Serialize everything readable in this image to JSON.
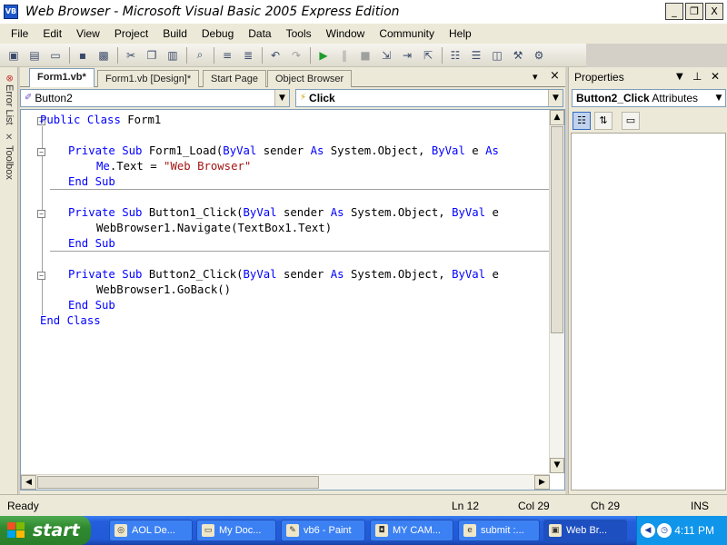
{
  "window": {
    "title": "Web Browser - Microsoft Visual Basic 2005 Express Edition",
    "minimize_icon": "_",
    "restore_icon": "❐",
    "close_icon": "X"
  },
  "menu": [
    "File",
    "Edit",
    "View",
    "Project",
    "Build",
    "Debug",
    "Data",
    "Tools",
    "Window",
    "Community",
    "Help"
  ],
  "toolbar": {
    "icons": [
      "add-project-icon",
      "add-item-icon",
      "open-icon",
      "save-icon",
      "save-all-icon",
      "cut-icon",
      "copy-icon",
      "paste-icon",
      "find-icon",
      "comment-icon",
      "uncomment-icon",
      "undo-icon",
      "redo-icon",
      "start-debug-icon",
      "pause-icon",
      "stop-icon",
      "step-into-icon",
      "step-over-icon",
      "step-out-icon",
      "solution-explorer-icon",
      "properties-icon",
      "object-browser-icon",
      "toolbox-icon",
      "options-icon"
    ]
  },
  "side_tabs": {
    "error_list": "Error List",
    "toolbox": "Toolbox"
  },
  "tabs": [
    {
      "label": "Form1.vb*",
      "active": true
    },
    {
      "label": "Form1.vb [Design]*",
      "active": false
    },
    {
      "label": "Start Page",
      "active": false
    },
    {
      "label": "Object Browser",
      "active": false
    }
  ],
  "tab_controls": {
    "dropdown": "▾",
    "close": "×"
  },
  "navigation": {
    "class_combo": "Button2",
    "method_combo": "Click"
  },
  "code": {
    "line1_kw1": "Public",
    "line1_kw2": "Class",
    "line1_name": "Form1",
    "sub1_kw1": "Private",
    "sub1_kw2": "Sub",
    "sub1_name": "Form1_Load(",
    "sub1_kw3": "ByVal",
    "sub1_mid1": "sender",
    "sub1_kw4": "As",
    "sub1_mid2": "System.Object,",
    "sub1_kw5": "ByVal",
    "sub1_mid3": "e",
    "sub1_kw6": "As",
    "sub1_body1_kw": "Me",
    "sub1_body1": ".Text = ",
    "sub1_body1_str": "\"Web Browser\"",
    "end_kw1": "End",
    "end_kw2": "Sub",
    "sub2_name": "Button1_Click(",
    "sub2_body": "WebBrowser1.Navigate(TextBox1.Text)",
    "sub3_name": "Button2_Click(",
    "sub3_body": "WebBrowser1.GoBack()",
    "end_class_kw1": "End",
    "end_class_kw2": "Class"
  },
  "properties": {
    "title": "Properties",
    "selected_object": "Button2_Click",
    "selected_type": "Attributes",
    "tool_icons": [
      "categorized-icon",
      "alphabetical-icon",
      "property-pages-icon"
    ]
  },
  "status": {
    "state": "Ready",
    "line": "Ln 12",
    "col": "Col 29",
    "ch": "Ch 29",
    "mode": "INS"
  },
  "taskbar": {
    "start_label": "start",
    "tasks": [
      {
        "label": "AOL De...",
        "icon": "aol-icon"
      },
      {
        "label": "My Doc...",
        "icon": "folder-icon"
      },
      {
        "label": "vb6 - Paint",
        "icon": "paint-icon"
      },
      {
        "label": "MY CAM...",
        "icon": "camera-icon"
      },
      {
        "label": "submit :...",
        "icon": "browser-icon"
      },
      {
        "label": "Web Br...",
        "icon": "app-window-icon"
      }
    ],
    "clock": "4:11 PM"
  }
}
